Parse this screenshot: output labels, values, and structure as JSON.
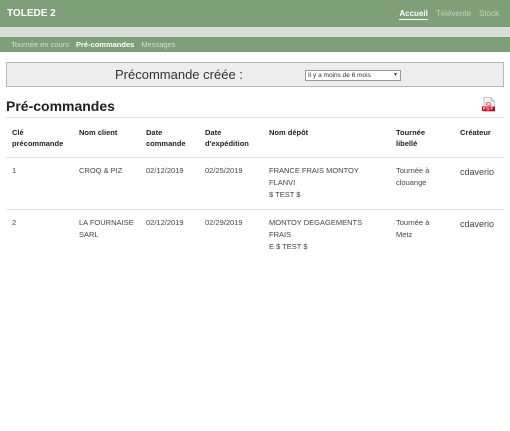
{
  "app": {
    "brand": "TOLEDE 2",
    "top_nav": [
      {
        "label": "Accueil",
        "active": true
      },
      {
        "label": "Télévente",
        "active": false
      },
      {
        "label": "Stock",
        "active": false
      }
    ],
    "sub_nav": [
      {
        "label": "Tournée en cours",
        "active": false
      },
      {
        "label": "Pré-commandes",
        "active": true
      },
      {
        "label": "Messages",
        "active": false
      }
    ]
  },
  "filter": {
    "label": "Précommande créée :",
    "selected": "Il y a moins de 6 mois"
  },
  "section": {
    "title": "Pré-commandes",
    "export_icon": "pdf-icon"
  },
  "table": {
    "headers": {
      "key_line1": "Clé",
      "key_line2": "précommande",
      "client": "Nom client",
      "order_line1": "Date",
      "order_line2": "commande",
      "ship_line1": "Date",
      "ship_line2": "d'expédition",
      "depot": "Nom dépôt",
      "tour_line1": "Tournée",
      "tour_line2": "libellé",
      "creator": "Créateur"
    },
    "rows": [
      {
        "key": "1",
        "client": "CROQ & PIZ",
        "order_date": "02/12/2019",
        "ship_date": "02/25/2019",
        "depot_line1": "FRANCE FRAIS MONTOY FLANVI",
        "depot_line2": "$ TEST $",
        "tour_line1": "Tournée à",
        "tour_line2": "clouange",
        "creator": "cdaverio"
      },
      {
        "key": "2",
        "client_line1": "LA FOURNAISE",
        "client_line2": "SARL",
        "order_date": "02/12/2019",
        "ship_date": "02/29/2019",
        "depot_line1": "MONTOY DEGAGEMENTS FRAIS",
        "depot_line2": "E $ TEST $",
        "tour_line1": "Tournée à",
        "tour_line2": "Metz",
        "creator": "cdaverio"
      }
    ]
  },
  "colors": {
    "header_green": "#7e9f78",
    "filter_bg": "#ededed"
  }
}
